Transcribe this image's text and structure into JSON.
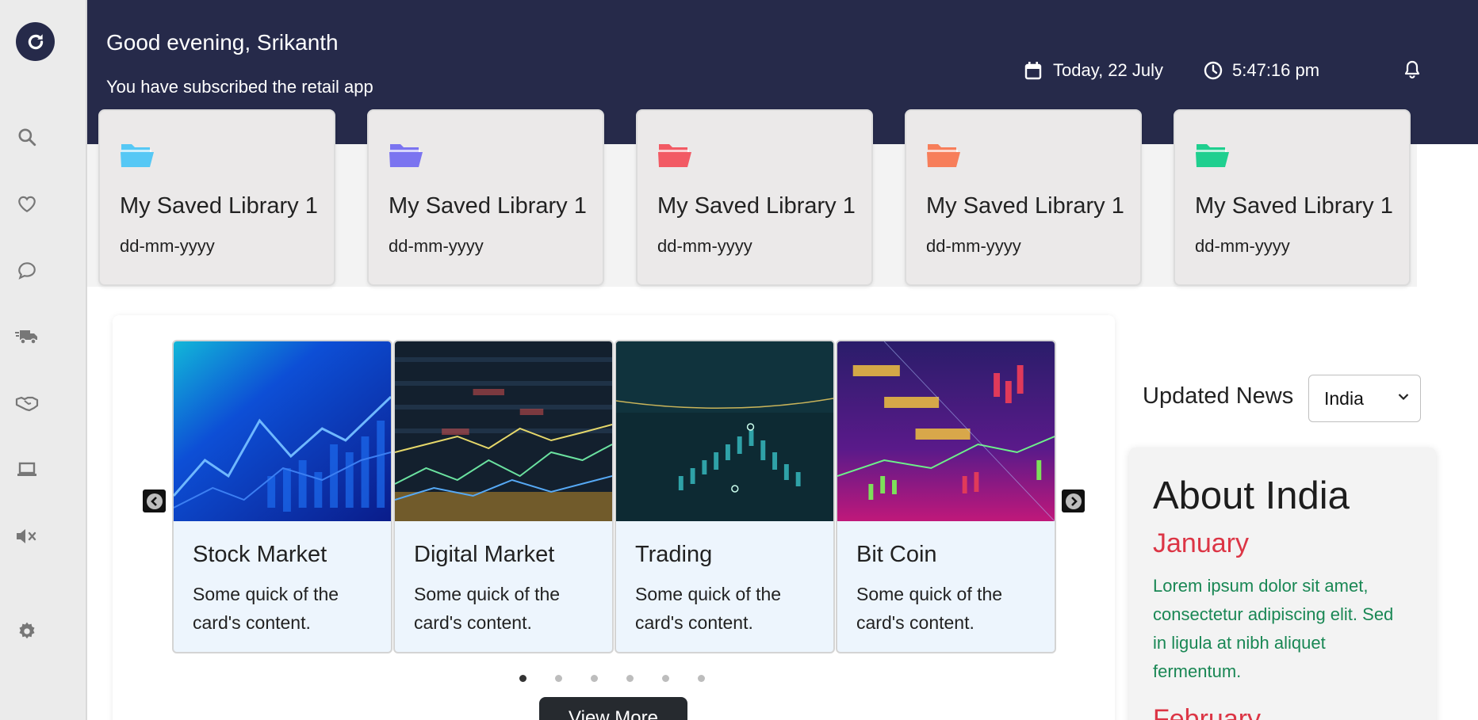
{
  "colors": {
    "header_bg": "#262a4a",
    "sidebar_bg": "#ebebeb",
    "folder_colors": [
      "#56c8f5",
      "#7b74f0",
      "#f25a64",
      "#f77e5a",
      "#1fcf8f"
    ],
    "month_red": "#dc3545",
    "body_green": "#198754"
  },
  "sidebar": {
    "logo_icon": "refresh-icon",
    "items": [
      {
        "icon": "search-icon"
      },
      {
        "icon": "heart-icon"
      },
      {
        "icon": "chat-icon"
      },
      {
        "icon": "delivery-truck-icon"
      },
      {
        "icon": "handshake-icon"
      },
      {
        "icon": "laptop-icon"
      },
      {
        "icon": "mute-icon"
      },
      {
        "icon": "gear-icon"
      }
    ]
  },
  "header": {
    "greeting": "Good evening, Srikanth",
    "subtitle": "You have subscribed the retail app",
    "date": "Today, 22 July",
    "time": "5:47:16 pm",
    "notification_icon": "bell-icon"
  },
  "libraries": [
    {
      "title": "My Saved Library 1",
      "date": "dd-mm-yyyy"
    },
    {
      "title": "My Saved Library 1",
      "date": "dd-mm-yyyy"
    },
    {
      "title": "My Saved Library 1",
      "date": "dd-mm-yyyy"
    },
    {
      "title": "My Saved Library 1",
      "date": "dd-mm-yyyy"
    },
    {
      "title": "My Saved Library 1",
      "date": "dd-mm-yyyy"
    }
  ],
  "carousel": {
    "slides": [
      {
        "title": "Stock Market",
        "text": "Some quick of the card's content."
      },
      {
        "title": "Digital Market",
        "text": "Some quick of the card's content."
      },
      {
        "title": "Trading",
        "text": "Some quick of the card's content."
      },
      {
        "title": "Bit Coin",
        "text": "Some quick of the card's content."
      }
    ],
    "page_count": 6,
    "active_page": 1,
    "view_more_label": "View More"
  },
  "news": {
    "label": "Updated News",
    "selected_country": "India",
    "card_title": "About India",
    "entries": [
      {
        "month": "January",
        "body": "Lorem ipsum dolor sit amet, consectetur adipiscing elit. Sed in ligula at nibh aliquet fermentum."
      },
      {
        "month": "February"
      }
    ]
  }
}
